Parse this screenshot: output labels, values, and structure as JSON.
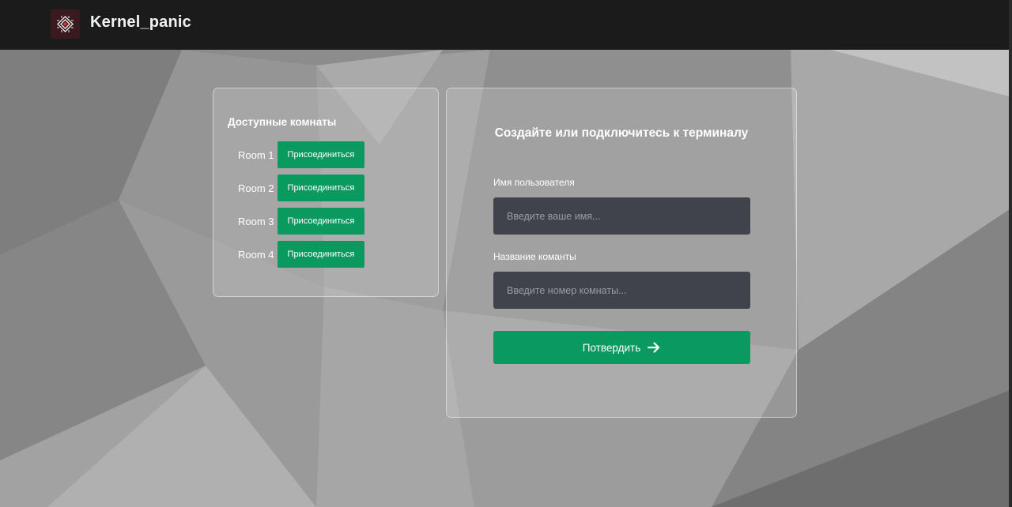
{
  "header": {
    "brand": "Kernel_panic",
    "logo_icon": "diamond-chip-logo-icon"
  },
  "rooms_panel": {
    "title": "Доступные комнаты",
    "rooms": [
      {
        "name": "Room 1",
        "button": "Присоединиться"
      },
      {
        "name": "Room 2",
        "button": "Присоединиться"
      },
      {
        "name": "Room 3",
        "button": "Присоединиться"
      },
      {
        "name": "Room 4",
        "button": "Присоединиться"
      }
    ]
  },
  "form": {
    "title": "Создайте или подключитесь к терминалу",
    "username": {
      "label": "Имя пользователя",
      "value": "",
      "placeholder": "Введите ваше имя..."
    },
    "room": {
      "label": "Название команты",
      "value": "",
      "placeholder": "Введите номер комнаты..."
    },
    "submit": {
      "label": "Потвердить",
      "icon": "arrow-right-icon"
    }
  },
  "colors": {
    "topbar": "#1b1b1b",
    "accent_green": "#0a9a5f",
    "input_bg": "#40434b",
    "logo_bg": "#3a1a1e"
  }
}
